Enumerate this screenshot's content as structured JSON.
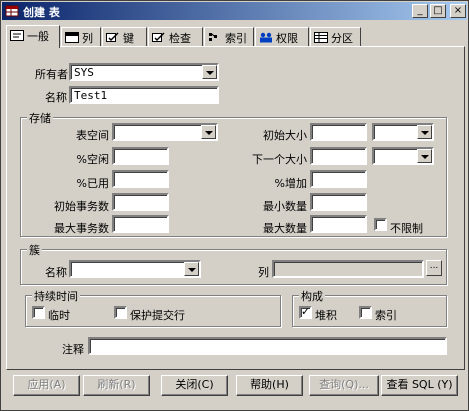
{
  "window": {
    "title": "创建 表",
    "minimize": "_",
    "maximize": "□",
    "close": "×"
  },
  "tabs": [
    {
      "label": "一般",
      "icon": "general-tab-icon"
    },
    {
      "label": "列",
      "icon": "columns-tab-icon"
    },
    {
      "label": "键",
      "icon": "key-tab-icon"
    },
    {
      "label": "检查",
      "icon": "check-tab-icon"
    },
    {
      "label": "索引",
      "icon": "index-tab-icon"
    },
    {
      "label": "权限",
      "icon": "users-tab-icon"
    },
    {
      "label": "分区",
      "icon": "table-tab-icon"
    }
  ],
  "general": {
    "owner_label": "所有者",
    "owner_value": "SYS",
    "name_label": "名称",
    "name_value": "Test1"
  },
  "storage": {
    "title": "存储",
    "tablespace_label": "表空间",
    "pctfree_label": "%空闲",
    "pctused_label": "%已用",
    "initrans_label": "初始事务数",
    "maxtrans_label": "最大事务数",
    "initial_label": "初始大小",
    "next_label": "下一个大小",
    "pctincrease_label": "%增加",
    "minextents_label": "最小数量",
    "maxextents_label": "最大数量",
    "unlimited_label": "不限制"
  },
  "cluster": {
    "title": "簇",
    "name_label": "名称",
    "columns_label": "列",
    "browse": "..."
  },
  "duration": {
    "title": "持续时间",
    "temporary_label": "临时",
    "preserve_label": "保护提交行"
  },
  "organization": {
    "title": "构成",
    "heap_label": "堆积",
    "heap_checked": true,
    "index_label": "索引"
  },
  "comment_label": "注释",
  "buttons": {
    "apply": "应用(A)",
    "refresh": "刷新(R)",
    "close": "关闭(C)",
    "help": "帮助(H)",
    "query": "查询(Q)...",
    "view_sql": "查看 SQL (Y)"
  }
}
